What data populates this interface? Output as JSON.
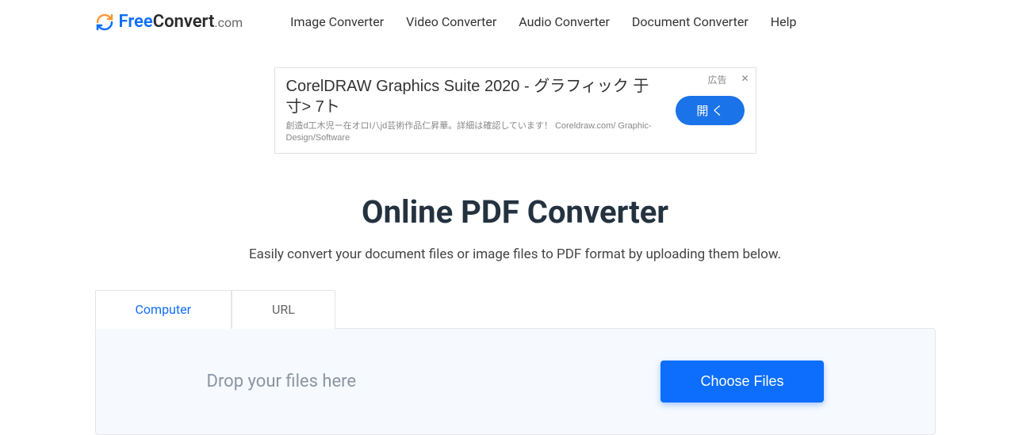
{
  "logo": {
    "free": "Free",
    "convert": "Convert",
    "com": ".com"
  },
  "nav": {
    "image": "Image Converter",
    "video": "Video Converter",
    "audio": "Audio Converter",
    "document": "Document Converter",
    "help": "Help"
  },
  "ad": {
    "label": "広告",
    "close": "✕",
    "title": "CorelDRAW Graphics Suite 2020 - グラフィック 于寸> 7ト",
    "desc": "創造d工木児ー在オロI八jd芸術作品仁昇華。詳細は確認しています！ Coreldraw.com/ Graphic-Design/Software",
    "button": "開 く"
  },
  "main": {
    "title": "Online PDF Converter",
    "subtitle": "Easily convert your document files or image files to PDF format by uploading them below."
  },
  "tabs": {
    "computer": "Computer",
    "url": "URL"
  },
  "dropzone": {
    "text": "Drop your files here",
    "button": "Choose Files"
  }
}
